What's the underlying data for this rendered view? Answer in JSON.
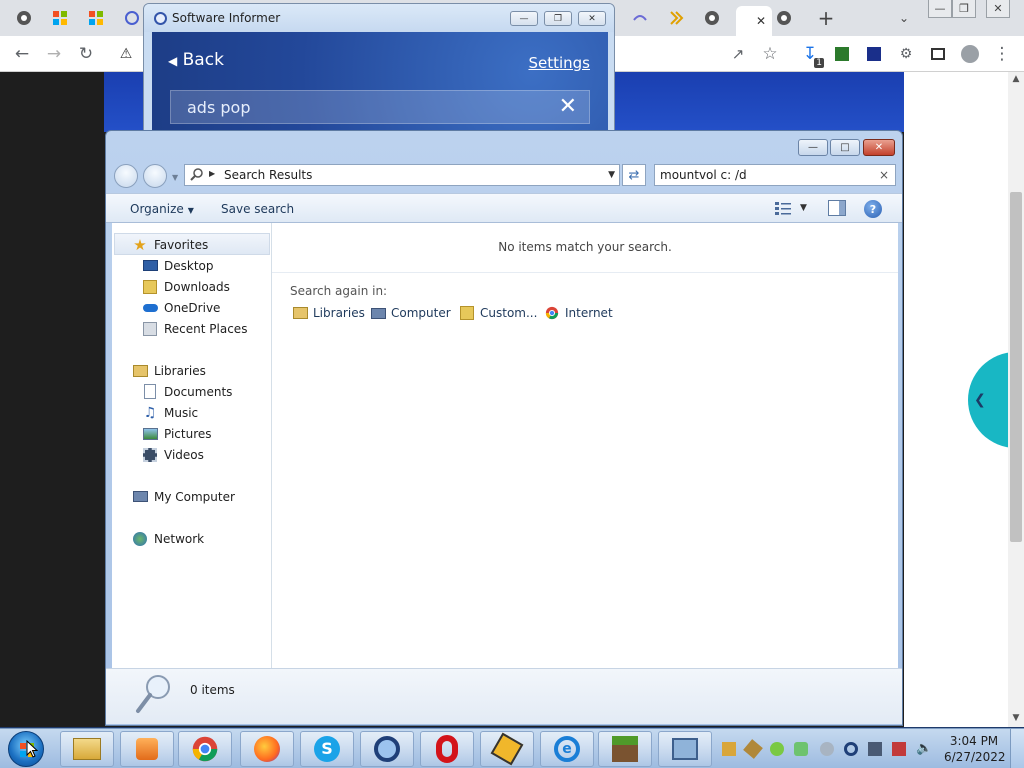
{
  "colors": {
    "accent": "#3d6fb0",
    "explorer_frame": "#a9c3e6",
    "informer_blue": "#23489a",
    "teal": "#18b7c4"
  },
  "browser": {
    "tab_icons": [
      "chrome-icon",
      "microsoft-icon",
      "microsoft-icon",
      "chrome-icon",
      "arc-icon",
      "arrow-icon",
      "chrome-icon",
      "chrome-icon"
    ],
    "new_tab_label": "+",
    "active_tab_close": "✕",
    "toolbar_icons": [
      "back-icon",
      "forward-icon",
      "reload-icon",
      "warning-icon",
      "share-icon",
      "star-icon",
      "download-icon",
      "extension-icon",
      "extension-icon",
      "puzzle-icon",
      "sidebar-icon",
      "profile-icon",
      "menu-icon"
    ],
    "download_badge": "1"
  },
  "informer": {
    "title": "Software Informer",
    "back_label": "Back",
    "settings_label": "Settings",
    "search_value": "ads pop",
    "clear_label": "✕"
  },
  "explorer": {
    "address": {
      "path_label": "Search Results"
    },
    "search": {
      "value": "mountvol c: /d",
      "clear_label": "×"
    },
    "commandbar": {
      "organize_label": "Organize",
      "save_search_label": "Save search",
      "help_label": "?"
    },
    "nav": {
      "favorites": {
        "label": "Favorites",
        "items": [
          "Desktop",
          "Downloads",
          "OneDrive",
          "Recent Places"
        ]
      },
      "libraries": {
        "label": "Libraries",
        "items": [
          "Documents",
          "Music",
          "Pictures",
          "Videos"
        ]
      },
      "computer_label": "My Computer",
      "network_label": "Network"
    },
    "content": {
      "empty_message": "No items match your search.",
      "search_again_label": "Search again in:",
      "search_again_links": [
        "Libraries",
        "Computer",
        "Custom...",
        "Internet"
      ]
    },
    "details": {
      "item_count": "0 items"
    }
  },
  "taskbar": {
    "apps": [
      "file-explorer-icon",
      "media-player-icon",
      "chrome-icon",
      "firefox-icon",
      "skype-icon",
      "q-app-icon",
      "opera-icon",
      "winamp-icon",
      "internet-explorer-icon",
      "minecraft-icon",
      "network-app-icon"
    ],
    "clock": {
      "time": "3:04 PM",
      "date": "6/27/2022"
    }
  }
}
